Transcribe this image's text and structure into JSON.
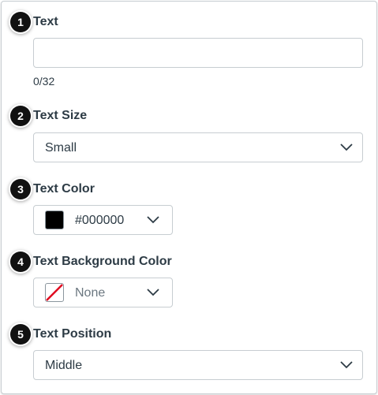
{
  "fields": {
    "text": {
      "number": "1",
      "label": "Text",
      "value": "",
      "counter": "0/32"
    },
    "text_size": {
      "number": "2",
      "label": "Text Size",
      "value": "Small"
    },
    "text_color": {
      "number": "3",
      "label": "Text Color",
      "value": "#000000",
      "swatch_color": "#000000"
    },
    "text_background_color": {
      "number": "4",
      "label": "Text Background Color",
      "value": "None",
      "swatch_icon": "none-slash-icon"
    },
    "text_position": {
      "number": "5",
      "label": "Text Position",
      "value": "Middle"
    }
  }
}
